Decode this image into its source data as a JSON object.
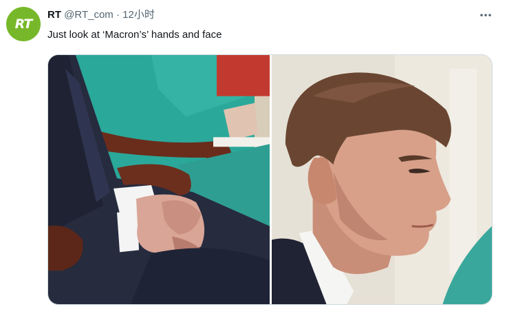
{
  "author": {
    "display_name": "RT",
    "handle": "@RT_com",
    "separator": "·",
    "timestamp": "12小时",
    "avatar_text": "RT"
  },
  "tweet": {
    "text": "Just look at ‘Macron’s’ hands and face"
  },
  "colors": {
    "avatar_bg": "#77b82a",
    "text_primary": "#0f1419",
    "text_secondary": "#536471"
  },
  "icons": {
    "more": "more-options-icon"
  }
}
